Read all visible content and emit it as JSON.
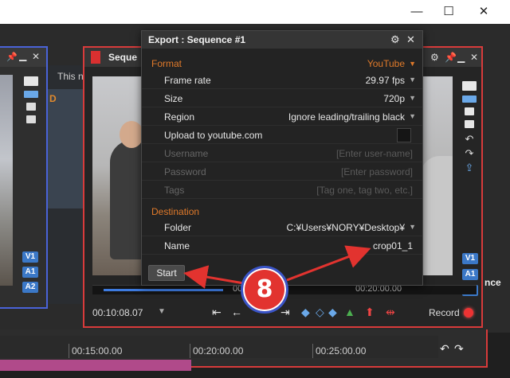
{
  "window": {
    "minimize": "—",
    "maximize": "☐",
    "close": "✕"
  },
  "left_panel": {
    "tracks": [
      "V1",
      "A1",
      "A2"
    ]
  },
  "middle": {
    "partial_text": "This n",
    "col_letter": "D"
  },
  "sequence": {
    "title": "Seque",
    "ruler_time": "00:10",
    "ruler_time2": "00:20:00.00",
    "timecode": "00:10:08.07",
    "record_label": "Record",
    "tracks": [
      "V1",
      "A1",
      "A2"
    ],
    "right_edge_text": "nce"
  },
  "timeline": {
    "labels": [
      "00:15:00.00",
      "00:20:00.00",
      "00:25:00.00"
    ]
  },
  "export_dialog": {
    "title": "Export : Sequence #1",
    "format": {
      "label": "Format",
      "value": "YouTube"
    },
    "rows": [
      {
        "label": "Frame rate",
        "value": "29.97 fps"
      },
      {
        "label": "Size",
        "value": "720p"
      },
      {
        "label": "Region",
        "value": "Ignore leading/trailing black"
      },
      {
        "label": "Upload to youtube.com"
      },
      {
        "label": "Username",
        "placeholder": "[Enter user-name]"
      },
      {
        "label": "Password",
        "placeholder": "[Enter password]"
      },
      {
        "label": "Tags",
        "placeholder": "[Tag one, tag two, etc.]"
      }
    ],
    "destination": {
      "label": "Destination",
      "folder": {
        "label": "Folder",
        "value": "C:¥Users¥NORY¥Desktop¥"
      },
      "name": {
        "label": "Name",
        "value": "crop01_1"
      }
    },
    "start_label": "Start"
  },
  "annotation": {
    "badge_number": "8",
    "arrow_color": "#e2332f"
  }
}
